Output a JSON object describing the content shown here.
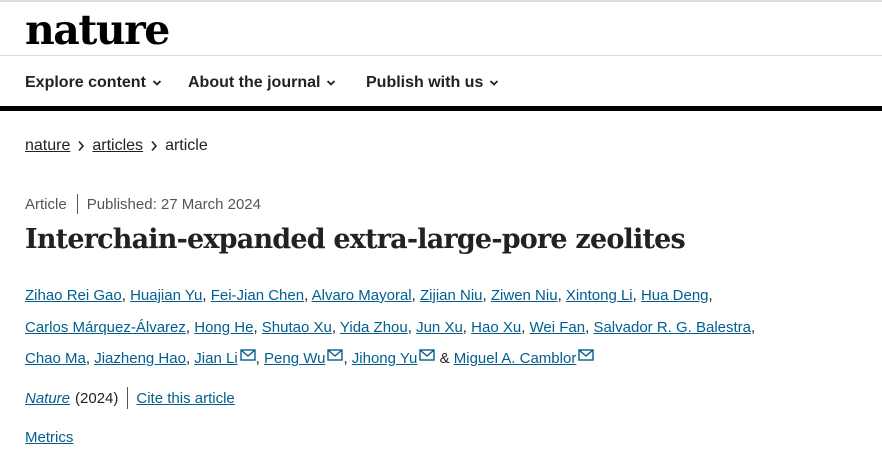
{
  "header": {
    "logo": "nature"
  },
  "nav": {
    "items": [
      {
        "label": "Explore content"
      },
      {
        "label": "About the journal"
      },
      {
        "label": "Publish with us"
      }
    ]
  },
  "breadcrumb": [
    "nature",
    "articles",
    "article"
  ],
  "article": {
    "type": "Article",
    "published": "Published: 27 March 2024",
    "title": "Interchain-expanded extra-large-pore zeolites",
    "authors": [
      "Zihao Rei Gao",
      "Huajian Yu",
      "Fei-Jian Chen",
      "Alvaro Mayoral",
      "Zijian Niu",
      "Ziwen Niu",
      "Xintong Li",
      "Hua Deng",
      "Carlos Márquez-Álvarez",
      "Hong He",
      "Shutao Xu",
      "Yida Zhou",
      "Jun Xu",
      "Hao Xu",
      "Wei Fan",
      "Salvador R. G. Balestra",
      "Chao Ma",
      "Jiazheng Hao",
      "Jian Li",
      "Peng Wu",
      "Jihong Yu",
      "Miguel A. Camblor"
    ],
    "ampersand": "&",
    "journal": "Nature",
    "year": "(2024)",
    "cite_label": "Cite this article",
    "metrics_label": "Metrics"
  },
  "colors": {
    "link": "#025e8d",
    "text": "#222222",
    "muted": "#555555"
  }
}
